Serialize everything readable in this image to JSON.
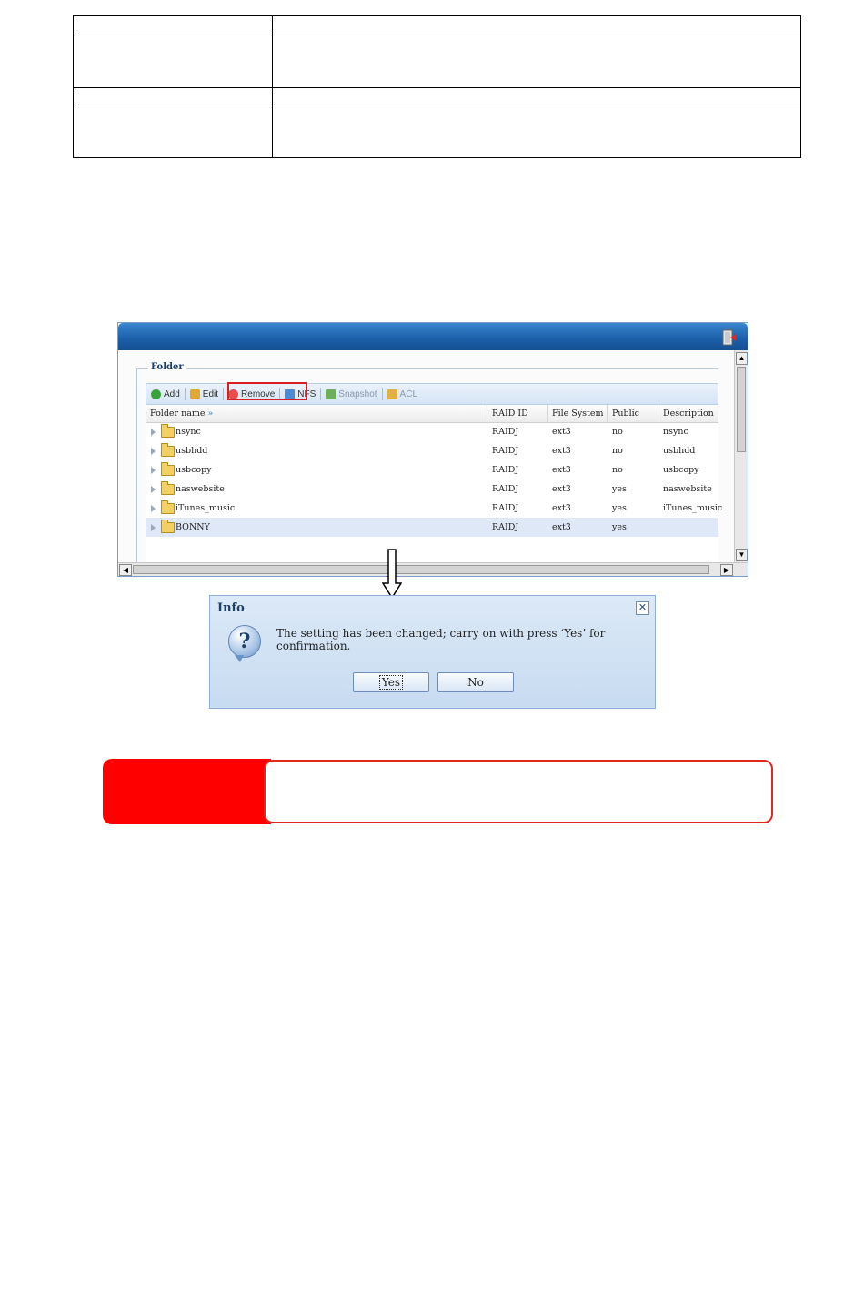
{
  "panel": {
    "legend": "Folder",
    "toolbar": {
      "add": "Add",
      "edit": "Edit",
      "remove": "Remove",
      "nfs": "NFS",
      "snapshot": "Snapshot",
      "acl": "ACL"
    },
    "columns": {
      "folder_name": "Folder name",
      "folder_name_suffix": "»",
      "raid_id": "RAID ID",
      "file_system": "File System",
      "public": "Public",
      "description": "Description"
    },
    "rows": [
      {
        "name": "nsync",
        "raid_id": "RAIDJ",
        "fs": "ext3",
        "public": "no",
        "description": "nsync"
      },
      {
        "name": "usbhdd",
        "raid_id": "RAIDJ",
        "fs": "ext3",
        "public": "no",
        "description": "usbhdd"
      },
      {
        "name": "usbcopy",
        "raid_id": "RAIDJ",
        "fs": "ext3",
        "public": "no",
        "description": "usbcopy"
      },
      {
        "name": "naswebsite",
        "raid_id": "RAIDJ",
        "fs": "ext3",
        "public": "yes",
        "description": "naswebsite"
      },
      {
        "name": "iTunes_music",
        "raid_id": "RAIDJ",
        "fs": "ext3",
        "public": "yes",
        "description": "iTunes_music"
      },
      {
        "name": "BONNY",
        "raid_id": "RAIDJ",
        "fs": "ext3",
        "public": "yes",
        "description": ""
      }
    ]
  },
  "dialog": {
    "title": "Info",
    "message": "The setting has been changed; carry on with press ‘Yes’ for confirmation.",
    "yes": "Yes",
    "no": "No",
    "close": "✕",
    "icon": "?"
  },
  "colors": {
    "title_bar": "#1a5fa8",
    "highlight": "#d81e1e",
    "note_red": "#ff0000"
  }
}
